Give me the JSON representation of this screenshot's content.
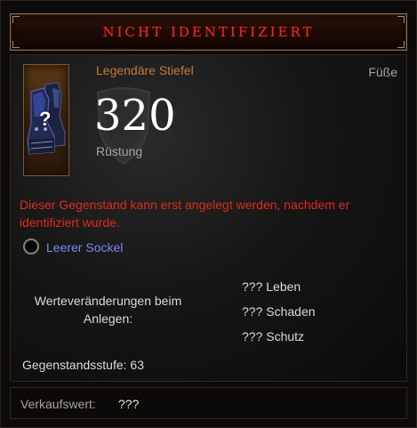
{
  "header": {
    "title": "NICHT IDENTIFIZIERT"
  },
  "item": {
    "type": "Legendäre Stiefel",
    "slot": "Füße",
    "armor_value": "320",
    "armor_label": "Rüstung",
    "icon": "unidentified-boots-icon",
    "question_mark": "?"
  },
  "requirement_text": "Dieser Gegenstand kann erst angelegt werden, nachdem er identifiziert wurde.",
  "socket": {
    "label": "Leerer Sockel"
  },
  "stats": {
    "label": "Werteveränderungen beim Anlegen:",
    "lines": [
      "??? Leben",
      "??? Schaden",
      "??? Schutz"
    ]
  },
  "item_level": "Gegenstandsstufe: 63",
  "sell": {
    "label": "Verkaufswert:",
    "value": "???"
  },
  "colors": {
    "title": "#e63320",
    "legendary": "#c27a3a",
    "requirement": "#e02a1a",
    "socket": "#7a86f2",
    "text": "#dedad2",
    "muted": "#a8a29a"
  }
}
